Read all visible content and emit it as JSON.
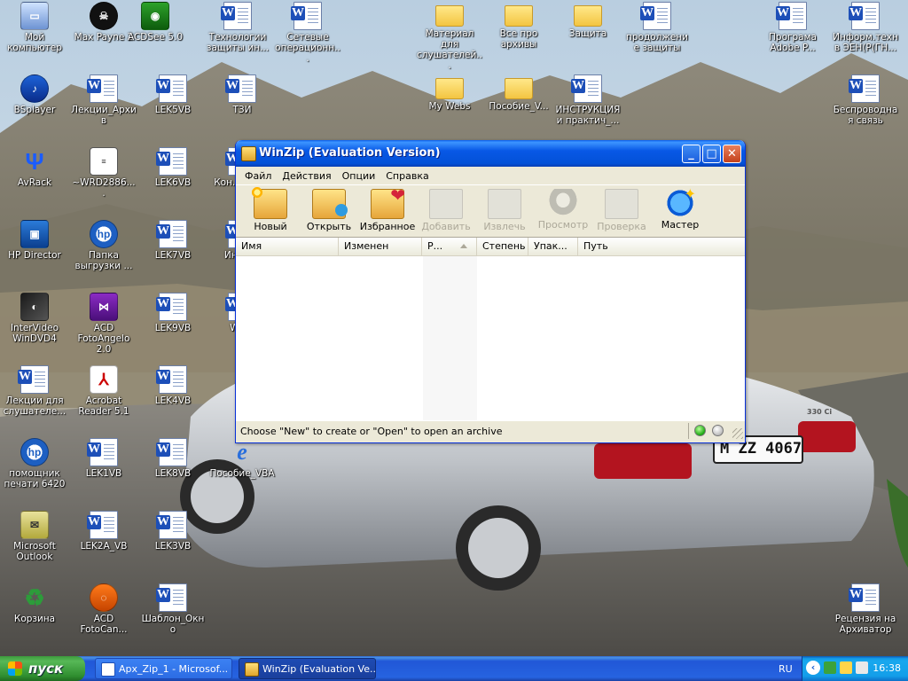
{
  "desktop": {
    "icons": [
      {
        "label": "Мой компьютер",
        "icon": "computer-icon"
      },
      {
        "label": "Max Payne 2",
        "icon": "max-payne-icon"
      },
      {
        "label": "ACDSee 5.0",
        "icon": "acdsee-icon"
      },
      {
        "label": "Технологии защиты ин...",
        "icon": "word-document-icon"
      },
      {
        "label": "Сетевые операционн...",
        "icon": "word-document-icon"
      },
      {
        "label": "Материал для слушателей...",
        "icon": "folder-icon"
      },
      {
        "label": "Все про архивы",
        "icon": "folder-icon"
      },
      {
        "label": "Защита",
        "icon": "folder-icon"
      },
      {
        "label": "продолжение защиты",
        "icon": "word-document-icon"
      },
      {
        "label": "Програма Adobe P...",
        "icon": "word-document-icon"
      },
      {
        "label": "Информ.техн в ЭЕН(Р(ГН...",
        "icon": "word-document-icon"
      },
      {
        "label": "BSplayer",
        "icon": "bsplayer-icon"
      },
      {
        "label": "Лекции_Архив",
        "icon": "word-document-icon"
      },
      {
        "label": "LEK5VB",
        "icon": "word-document-icon"
      },
      {
        "label": "ТЗИ",
        "icon": "word-document-icon"
      },
      {
        "label": "My Webs",
        "icon": "folder-icon"
      },
      {
        "label": "Пособие_V...",
        "icon": "folder-icon"
      },
      {
        "label": "ИНСТРУКЦИЯ и практич_...",
        "icon": "word-document-icon"
      },
      {
        "label": "Беспроводная связь",
        "icon": "word-document-icon"
      },
      {
        "label": "AvRack",
        "icon": "avrack-icon"
      },
      {
        "label": "~WRD2886....",
        "icon": "text-document-icon"
      },
      {
        "label": "LEK6VB",
        "icon": "word-document-icon"
      },
      {
        "label": "Кон... лек...",
        "icon": "word-document-icon"
      },
      {
        "label": "HP Director",
        "icon": "hp-director-icon"
      },
      {
        "label": "Папка выгрузки ...",
        "icon": "hp-folder-icon"
      },
      {
        "label": "LEK7VB",
        "icon": "word-document-icon"
      },
      {
        "label": "Инфо...",
        "icon": "word-document-icon"
      },
      {
        "label": "InterVideo WinDVD4",
        "icon": "windvd-icon"
      },
      {
        "label": "ACD FotoAngelo 2.0",
        "icon": "acd-fotoangelo-icon"
      },
      {
        "label": "LEK9VB",
        "icon": "word-document-icon"
      },
      {
        "label": "WZ...",
        "icon": "word-document-icon"
      },
      {
        "label": "Лекции для слушателе...",
        "icon": "word-document-icon"
      },
      {
        "label": "Acrobat Reader 5.1",
        "icon": "acrobat-icon"
      },
      {
        "label": "LEK4VB",
        "icon": "word-document-icon"
      },
      {
        "label": "помощник печати 6420",
        "icon": "hp-printer-icon"
      },
      {
        "label": "LEK1VB",
        "icon": "word-document-icon"
      },
      {
        "label": "LEK8VB",
        "icon": "word-document-icon"
      },
      {
        "label": "Пособие_VBA",
        "icon": "internet-explorer-icon"
      },
      {
        "label": "Microsoft Outlook",
        "icon": "outlook-icon"
      },
      {
        "label": "LEK2A_VB",
        "icon": "word-document-icon"
      },
      {
        "label": "LEK3VB",
        "icon": "word-document-icon"
      },
      {
        "label": "Корзина",
        "icon": "recycle-bin-icon"
      },
      {
        "label": "ACD FotoCan...",
        "icon": "acd-fotocanvas-icon"
      },
      {
        "label": "Шаблон_Окно",
        "icon": "word-document-icon"
      },
      {
        "label": "Рецензия на Архиватор",
        "icon": "word-document-icon"
      }
    ],
    "car_plate": "M ZZ 4067",
    "car_badge": "330 Ci"
  },
  "window": {
    "title": "WinZip (Evaluation Version)",
    "controls": {
      "minimize": "_",
      "maximize": "□",
      "close": "✕"
    },
    "menu": [
      "Файл",
      "Действия",
      "Опции",
      "Справка"
    ],
    "toolbar": [
      {
        "label": "Новый",
        "icon": "new-archive-icon",
        "enabled": true
      },
      {
        "label": "Открыть",
        "icon": "open-archive-icon",
        "enabled": true
      },
      {
        "label": "Избранное",
        "icon": "favorites-icon",
        "enabled": true
      },
      {
        "label": "Добавить",
        "icon": "add-icon",
        "enabled": false
      },
      {
        "label": "Извлечь",
        "icon": "extract-icon",
        "enabled": false
      },
      {
        "label": "Просмотр",
        "icon": "view-icon",
        "enabled": false
      },
      {
        "label": "Проверка",
        "icon": "check-icon",
        "enabled": false
      },
      {
        "label": "Мастер",
        "icon": "wizard-icon",
        "enabled": true
      }
    ],
    "columns": [
      "Имя",
      "Изменен",
      "Р...",
      "Степень",
      "Упак...",
      "Путь"
    ],
    "status_text": "Choose \"New\" to create or \"Open\" to open an archive"
  },
  "taskbar": {
    "start_label": "пуск",
    "tasks": [
      {
        "label": "Apx_Zip_1 - Microsof...",
        "icon": "word-document-icon"
      },
      {
        "label": "WinZip (Evaluation Ve...",
        "icon": "winzip-icon"
      }
    ],
    "language": "RU",
    "clock": "16:38"
  },
  "colors": {
    "titlebar": "#0858e6",
    "taskbar": "#2663e0",
    "start_button": "#3c9a3c",
    "window_face": "#ece9d8"
  }
}
